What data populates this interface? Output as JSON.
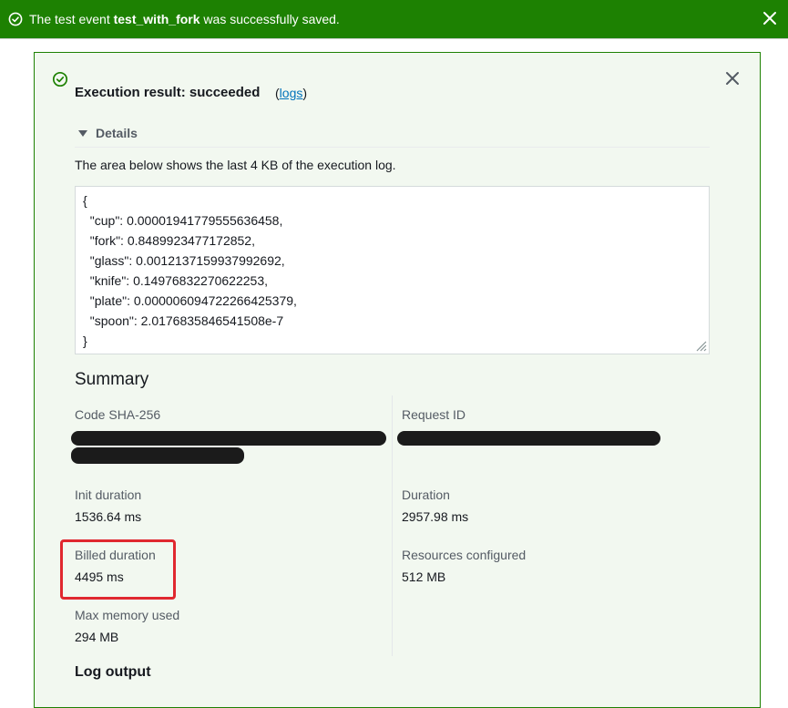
{
  "flash": {
    "prefix": "The test event ",
    "event_name": "test_with_fork",
    "suffix": " was successfully saved."
  },
  "result": {
    "title": "Execution result: succeeded",
    "logs_open": "(",
    "logs_link": "logs",
    "logs_close": ")",
    "details_label": "Details",
    "note": "The area below shows the last 4 KB of the execution log.",
    "log_lines": [
      "{",
      "  \"cup\": 0.00001941779555636458,",
      "  \"fork\": 0.8489923477172852,",
      "  \"glass\": 0.0012137159937992692,",
      "  \"knife\": 0.14976832270622253,",
      "  \"plate\": 0.000006094722266425379,",
      "  \"spoon\": 2.0176835846541508e-7",
      "}"
    ]
  },
  "summary": {
    "heading": "Summary",
    "code_sha_label": "Code SHA-256",
    "request_id_label": "Request ID",
    "init_duration_label": "Init duration",
    "init_duration_value": "1536.64 ms",
    "duration_label": "Duration",
    "duration_value": "2957.98 ms",
    "billed_label": "Billed duration",
    "billed_value": "4495 ms",
    "resources_label": "Resources configured",
    "resources_value": "512 MB",
    "max_memory_label": "Max memory used",
    "max_memory_value": "294 MB"
  },
  "log_output_heading": "Log output",
  "colors": {
    "success_green": "#1d8102",
    "panel_bg": "#f2f8f0",
    "link_blue": "#0073bb",
    "highlight_red": "#e0282f"
  },
  "icons": [
    "success-check-icon",
    "close-icon",
    "caret-down-icon",
    "resize-grip-icon"
  ]
}
